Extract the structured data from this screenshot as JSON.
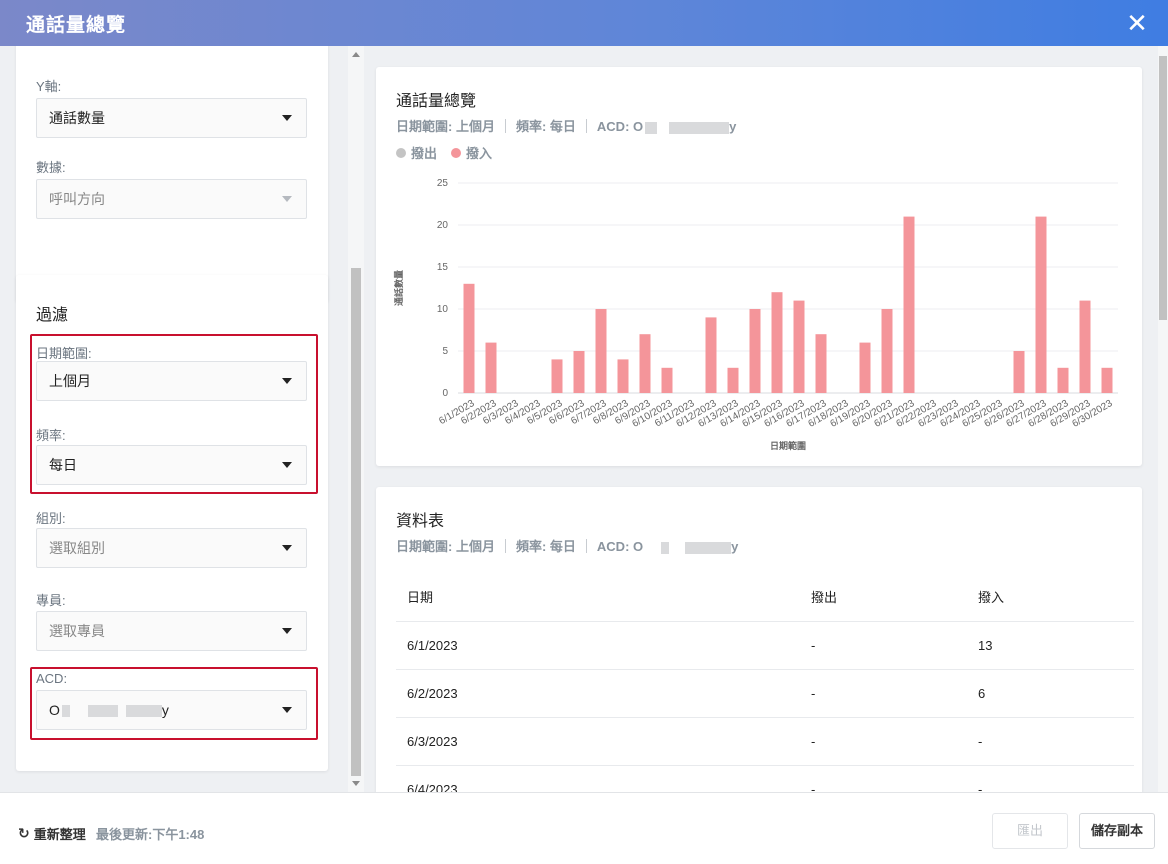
{
  "window": {
    "title": "通話量總覽"
  },
  "left": {
    "y_axis": {
      "label": "Y軸:",
      "value": "通話數量"
    },
    "data_field": {
      "label": "數據:",
      "value": "呼叫方向"
    },
    "filter": {
      "title": "過濾",
      "date_range": {
        "label": "日期範圍:",
        "value": "上個月"
      },
      "frequency": {
        "label": "頻率:",
        "value": "每日"
      },
      "group": {
        "label": "組別:",
        "placeholder": "選取組別"
      },
      "agent": {
        "label": "專員:",
        "placeholder": "選取專員"
      },
      "acd": {
        "label": "ACD:",
        "value_start": "O",
        "value_end": "y"
      }
    }
  },
  "chart_card": {
    "title": "通話量總覽",
    "meta": {
      "date_range": "日期範圍: 上個月",
      "frequency": "頻率: 每日",
      "acd_prefix": "ACD: O",
      "acd_suffix": "y"
    },
    "legend": [
      {
        "name": "撥出",
        "color": "#c4c4c4"
      },
      {
        "name": "撥入",
        "color": "#f4959a"
      }
    ]
  },
  "chart_data": {
    "type": "bar",
    "title": "",
    "xlabel": "日期範圍",
    "ylabel": "通話數量",
    "ylim": [
      0,
      25
    ],
    "yticks": [
      0,
      5,
      10,
      15,
      20,
      25
    ],
    "legend_position": "top-left",
    "grid": true,
    "categories": [
      "6/1/2023",
      "6/2/2023",
      "6/3/2023",
      "6/4/2023",
      "6/5/2023",
      "6/6/2023",
      "6/7/2023",
      "6/8/2023",
      "6/9/2023",
      "6/10/2023",
      "6/11/2023",
      "6/12/2023",
      "6/13/2023",
      "6/14/2023",
      "6/15/2023",
      "6/16/2023",
      "6/17/2023",
      "6/18/2023",
      "6/19/2023",
      "6/20/2023",
      "6/21/2023",
      "6/22/2023",
      "6/23/2023",
      "6/24/2023",
      "6/25/2023",
      "6/26/2023",
      "6/27/2023",
      "6/28/2023",
      "6/29/2023",
      "6/30/2023"
    ],
    "series": [
      {
        "name": "撥出",
        "color": "#c4c4c4",
        "values": [
          0,
          0,
          0,
          0,
          0,
          0,
          0,
          0,
          0,
          0,
          0,
          0,
          0,
          0,
          0,
          0,
          0,
          0,
          0,
          0,
          0,
          0,
          0,
          0,
          0,
          0,
          0,
          0,
          0,
          0
        ]
      },
      {
        "name": "撥入",
        "color": "#f4959a",
        "values": [
          13,
          6,
          0,
          0,
          4,
          5,
          10,
          4,
          7,
          3,
          0,
          9,
          3,
          10,
          12,
          11,
          7,
          0,
          6,
          10,
          21,
          0,
          0,
          0,
          0,
          5,
          21,
          3,
          11,
          3
        ]
      }
    ]
  },
  "table_card": {
    "title": "資料表",
    "meta": {
      "date_range": "日期範圍: 上個月",
      "frequency": "頻率: 每日",
      "acd_prefix": "ACD: O",
      "acd_suffix": "y"
    },
    "columns": [
      "日期",
      "撥出",
      "撥入"
    ],
    "rows": [
      [
        "6/1/2023",
        "-",
        "13"
      ],
      [
        "6/2/2023",
        "-",
        "6"
      ],
      [
        "6/3/2023",
        "-",
        "-"
      ],
      [
        "6/4/2023",
        "-",
        "-"
      ]
    ]
  },
  "footer": {
    "refresh_label": "重新整理",
    "last_updated": "最後更新:下午1:48",
    "export_label": "匯出",
    "save_copy_label": "儲存副本"
  }
}
